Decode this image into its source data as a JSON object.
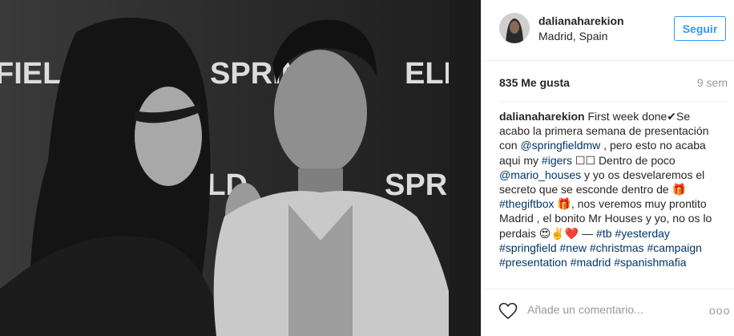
{
  "post": {
    "photo": "black-and-white-couple-photo"
  },
  "header": {
    "username": "dalianaharekion",
    "location": "Madrid, Spain",
    "follow_label": "Seguir"
  },
  "stats": {
    "likes": "835 Me gusta",
    "time": "9 sem"
  },
  "caption": {
    "username": "dalianaharekion",
    "parts": [
      {
        "t": "text",
        "v": " First week done✔Se acabo la primera semana de presentación con "
      },
      {
        "t": "link",
        "v": "@springfieldmw"
      },
      {
        "t": "text",
        "v": " , pero esto no acaba aqui my "
      },
      {
        "t": "link",
        "v": "#igers"
      },
      {
        "t": "text",
        "v": " ☐☐ Dentro de poco "
      },
      {
        "t": "link",
        "v": "@mario_houses"
      },
      {
        "t": "text",
        "v": " y yo os desvelaremos el secreto que se esconde dentro de 🎁 "
      },
      {
        "t": "link",
        "v": "#thegiftbox"
      },
      {
        "t": "text",
        "v": " 🎁, nos veremos muy prontito Madrid , el bonito Mr Houses y yo, no os lo perdais 😍✌️❤️ — "
      },
      {
        "t": "link",
        "v": "#tb"
      },
      {
        "t": "text",
        "v": " "
      },
      {
        "t": "link",
        "v": "#yesterday"
      },
      {
        "t": "text",
        "v": " "
      },
      {
        "t": "link",
        "v": "#springfield"
      },
      {
        "t": "text",
        "v": " "
      },
      {
        "t": "link",
        "v": "#new"
      },
      {
        "t": "text",
        "v": " "
      },
      {
        "t": "link",
        "v": "#christmas"
      },
      {
        "t": "text",
        "v": " "
      },
      {
        "t": "link",
        "v": "#campaign"
      },
      {
        "t": "text",
        "v": " "
      },
      {
        "t": "link",
        "v": "#presentation"
      },
      {
        "t": "text",
        "v": " "
      },
      {
        "t": "link",
        "v": "#madrid"
      },
      {
        "t": "text",
        "v": " "
      },
      {
        "t": "link",
        "v": "#spanishmafia"
      }
    ]
  },
  "footer": {
    "like_icon": "heart-icon",
    "comment_placeholder": "Añade un comentario...",
    "more_label": "ooo"
  },
  "colors": {
    "link": "#003569",
    "follow": "#3897f0",
    "muted": "#999999"
  }
}
